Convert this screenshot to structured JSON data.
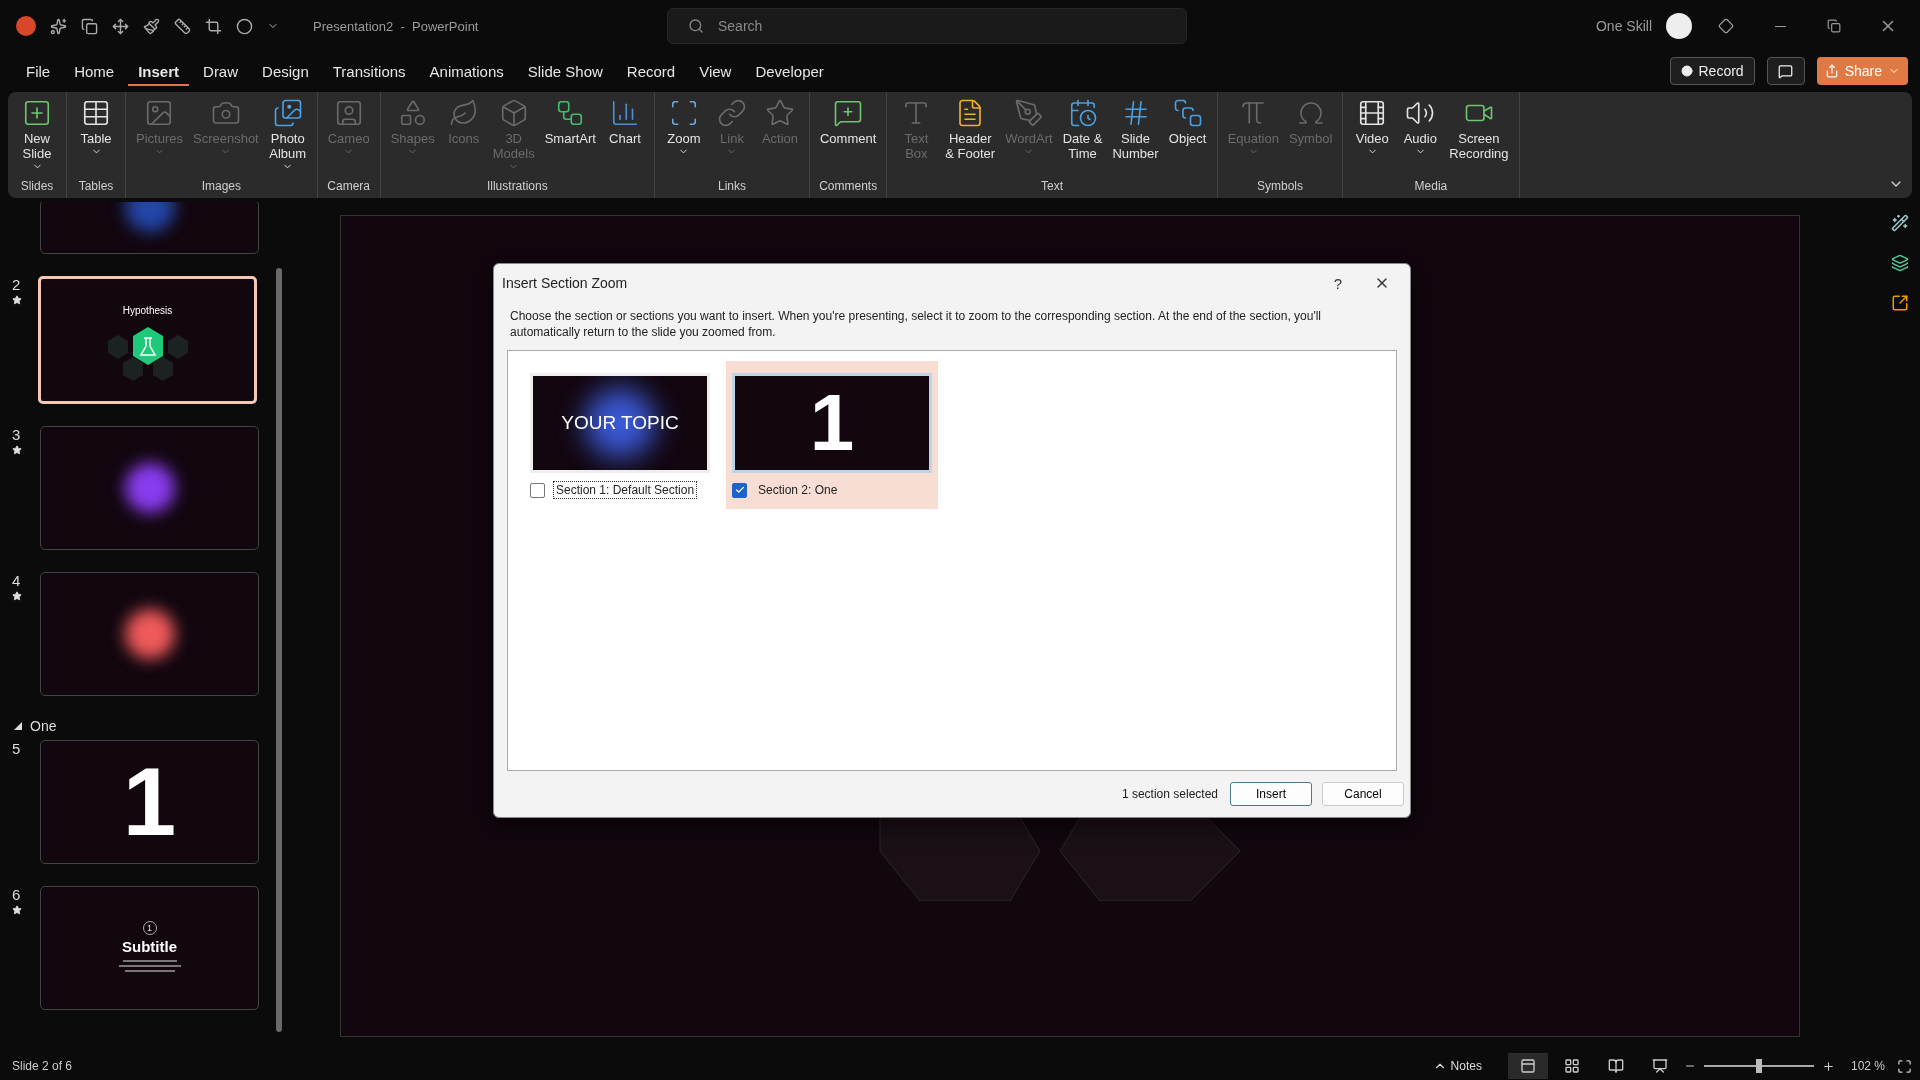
{
  "title_bar": {
    "document_title": "Presentation2  -  PowerPoint",
    "search": {
      "placeholder": "Search"
    },
    "user_name": "One Skill"
  },
  "menu_tabs": [
    {
      "label": "File",
      "selected": false
    },
    {
      "label": "Home",
      "selected": false
    },
    {
      "label": "Insert",
      "selected": true
    },
    {
      "label": "Draw",
      "selected": false
    },
    {
      "label": "Design",
      "selected": false
    },
    {
      "label": "Transitions",
      "selected": false
    },
    {
      "label": "Animations",
      "selected": false
    },
    {
      "label": "Slide Show",
      "selected": false
    },
    {
      "label": "Record",
      "selected": false
    },
    {
      "label": "View",
      "selected": false
    },
    {
      "label": "Developer",
      "selected": false
    }
  ],
  "top_buttons": {
    "record": "Record",
    "share": "Share"
  },
  "ribbon_groups": [
    {
      "label": "Slides",
      "buttons": [
        {
          "label": "New\nSlide",
          "disabled": false,
          "dropdown": true
        }
      ]
    },
    {
      "label": "Tables",
      "buttons": [
        {
          "label": "Table",
          "disabled": false,
          "dropdown": true
        }
      ]
    },
    {
      "label": "Images",
      "buttons": [
        {
          "label": "Pictures",
          "disabled": true,
          "dropdown": true
        },
        {
          "label": "Screenshot",
          "disabled": true,
          "dropdown": true
        },
        {
          "label": "Photo\nAlbum",
          "disabled": false,
          "dropdown": true
        }
      ]
    },
    {
      "label": "Camera",
      "buttons": [
        {
          "label": "Cameo",
          "disabled": true,
          "dropdown": true
        }
      ]
    },
    {
      "label": "Illustrations",
      "buttons": [
        {
          "label": "Shapes",
          "disabled": true,
          "dropdown": true
        },
        {
          "label": "Icons",
          "disabled": true,
          "dropdown": false
        },
        {
          "label": "3D\nModels",
          "disabled": true,
          "dropdown": true
        },
        {
          "label": "SmartArt",
          "disabled": false,
          "dropdown": false
        },
        {
          "label": "Chart",
          "disabled": false,
          "dropdown": false
        }
      ]
    },
    {
      "label": "Links",
      "buttons": [
        {
          "label": "Zoom",
          "disabled": false,
          "dropdown": true
        },
        {
          "label": "Link",
          "disabled": true,
          "dropdown": true
        },
        {
          "label": "Action",
          "disabled": true,
          "dropdown": false
        }
      ]
    },
    {
      "label": "Comments",
      "buttons": [
        {
          "label": "Comment",
          "disabled": false,
          "dropdown": false
        }
      ]
    },
    {
      "label": "Text",
      "buttons": [
        {
          "label": "Text\nBox",
          "disabled": true,
          "dropdown": false
        },
        {
          "label": "Header\n& Footer",
          "disabled": false,
          "dropdown": false
        },
        {
          "label": "WordArt",
          "disabled": true,
          "dropdown": true
        },
        {
          "label": "Date &\nTime",
          "disabled": false,
          "dropdown": false
        },
        {
          "label": "Slide\nNumber",
          "disabled": false,
          "dropdown": false
        },
        {
          "label": "Object",
          "disabled": false,
          "dropdown": false
        }
      ]
    },
    {
      "label": "Symbols",
      "buttons": [
        {
          "label": "Equation",
          "disabled": true,
          "dropdown": true
        },
        {
          "label": "Symbol",
          "disabled": true,
          "dropdown": false
        }
      ]
    },
    {
      "label": "Media",
      "buttons": [
        {
          "label": "Video",
          "disabled": false,
          "dropdown": true
        },
        {
          "label": "Audio",
          "disabled": false,
          "dropdown": true
        },
        {
          "label": "Screen\nRecording",
          "disabled": false,
          "dropdown": false
        }
      ]
    }
  ],
  "slides": [
    {
      "kind": "cut",
      "selected": false
    },
    {
      "kind": "hexagons",
      "number": "2",
      "animated": true,
      "selected": true,
      "title": "Hypothesis"
    },
    {
      "kind": "glow",
      "number": "3",
      "animated": true,
      "selected": false,
      "color": "#8a3cf0"
    },
    {
      "kind": "glow",
      "number": "4",
      "animated": true,
      "selected": false,
      "color": "#f05a5a"
    },
    {
      "kind": "section",
      "title": "One",
      "expanded": true
    },
    {
      "kind": "numeral",
      "number": "5",
      "animated": false,
      "selected": false,
      "title": "1"
    },
    {
      "kind": "subtitle",
      "number": "6",
      "animated": true,
      "selected": false,
      "title": "Subtitle",
      "badge": "1"
    }
  ],
  "dialog": {
    "title": "Insert Section Zoom",
    "help": "?",
    "description": "Choose the section or sections you want to insert. When you're presenting, select it to zoom to the corresponding section. At the end of the section, you'll automatically return to the slide you zoomed from.",
    "sections": [
      {
        "label": "Section 1: Default Section",
        "checked": false,
        "selected": false,
        "preview": "YOUR TOPIC",
        "kind": "topic"
      },
      {
        "label": "Section 2: One",
        "checked": true,
        "selected": true,
        "preview": "1",
        "kind": "numeral"
      }
    ],
    "status": "1 section selected",
    "buttons": [
      "Insert",
      "Cancel"
    ]
  },
  "status_bar": {
    "slide_info": "Slide 2 of 6",
    "notes": "Notes",
    "views": [
      {
        "selected": true
      },
      {
        "selected": false
      },
      {
        "selected": false
      },
      {
        "selected": false
      }
    ],
    "zoom": {
      "level": 0.5,
      "reading": "102 %"
    }
  }
}
